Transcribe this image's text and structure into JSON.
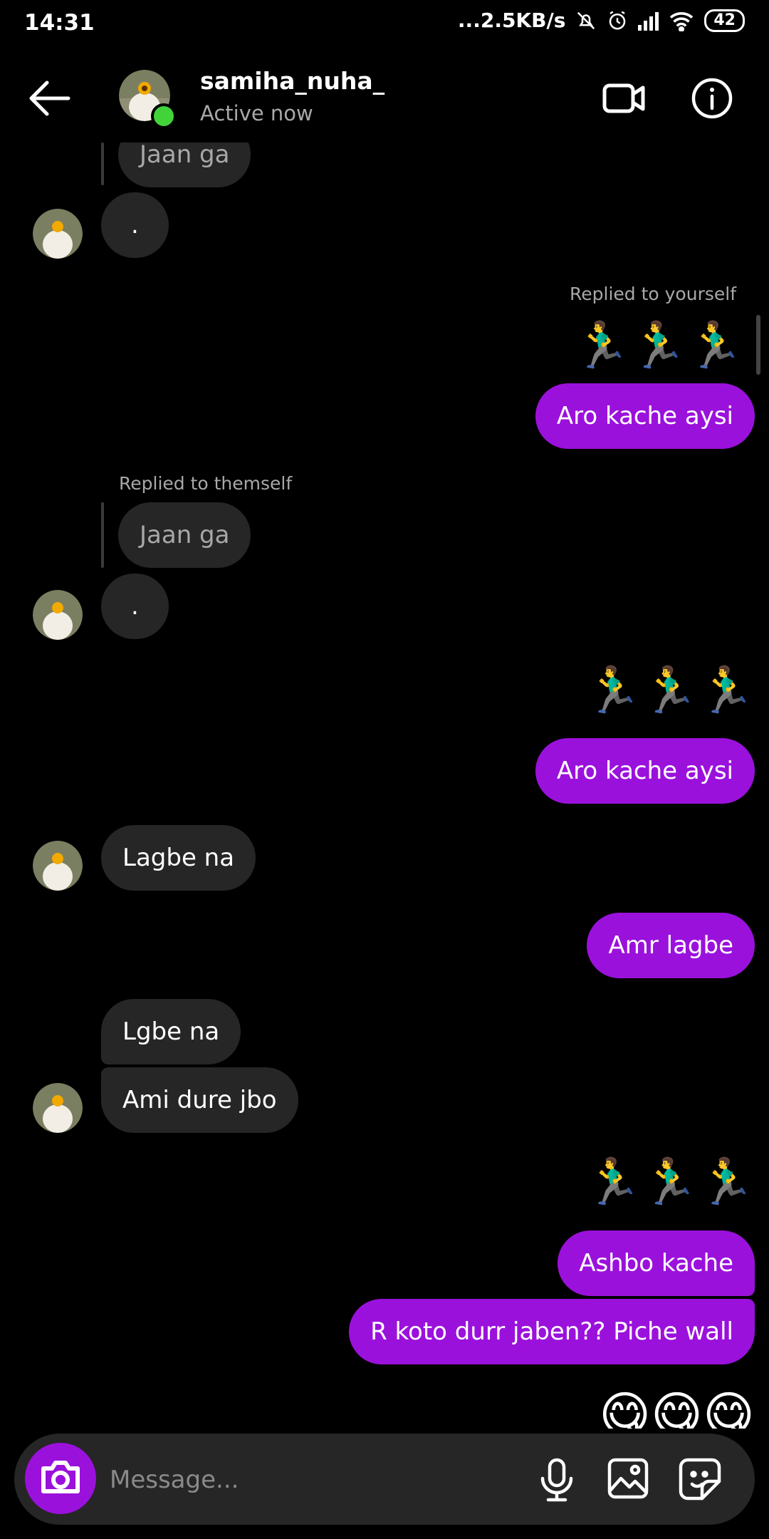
{
  "status_bar": {
    "time": "14:31",
    "net_speed": "...2.5KB/s",
    "battery": "42"
  },
  "header": {
    "username": "samiha_nuha_",
    "presence": "Active now"
  },
  "messages": {
    "top_quoted": "Jaan ga",
    "dot1": ".",
    "replied_yourself": "Replied to yourself",
    "runners1": "🏃‍♂️🏃‍♂️🏃‍♂️",
    "aro1": "Aro kache aysi",
    "replied_themself": "Replied to themself",
    "quoted2": "Jaan ga",
    "dot2": ".",
    "runners2": "🏃‍♂️🏃‍♂️🏃‍♂️",
    "aro2": "Aro kache aysi",
    "lagbe_na": "Lagbe na",
    "amr_lagbe": "Amr lagbe",
    "lgbe_na": "Lgbe na",
    "ami_dure": "Ami dure jbo",
    "runners3": "🏃‍♂️🏃‍♂️🏃‍♂️",
    "ashbo": "Ashbo kache",
    "r_koto": "R koto durr jaben?? Piche wall",
    "yum": "😋😋😋"
  },
  "composer": {
    "placeholder": "Message..."
  },
  "colors": {
    "accent": "#9b11dc",
    "incoming_bubble": "#262626",
    "online": "#42d33a"
  }
}
